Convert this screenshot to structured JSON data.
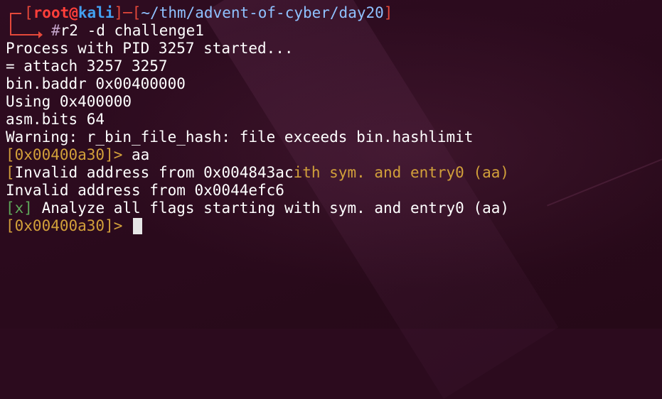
{
  "prompt": {
    "user": "root",
    "at": "@",
    "host": "kali",
    "path": "~/thm/advent-of-cyber/day20",
    "hash": "#",
    "command": "r2 -d challenge1"
  },
  "output": {
    "line1": "Process with PID 3257 started...",
    "line2": "= attach 3257 3257",
    "line3": "bin.baddr 0x00400000",
    "line4": "Using 0x400000",
    "line5": "asm.bits 64",
    "line6": "Warning: r_bin_file_hash: file exceeds bin.hashlimit"
  },
  "r2": {
    "address": "[0x00400a30]>",
    "cmd1": "aa",
    "invalid1_prefix": "[Invalid address from 0x004843ac",
    "invalid1_suffix": "ith sym. and entry0 (aa)",
    "invalid2": "Invalid address from 0x0044efc6",
    "analyze_mark": "[x]",
    "analyze_text": "Analyze all flags starting with sym. and entry0 (aa)"
  },
  "colors": {
    "background": "#2c0b1e",
    "prompt_red": "#e4483a",
    "host_blue": "#43a0f0",
    "r2_yellow": "#d2a03a",
    "ok_green": "#5fa85a"
  }
}
